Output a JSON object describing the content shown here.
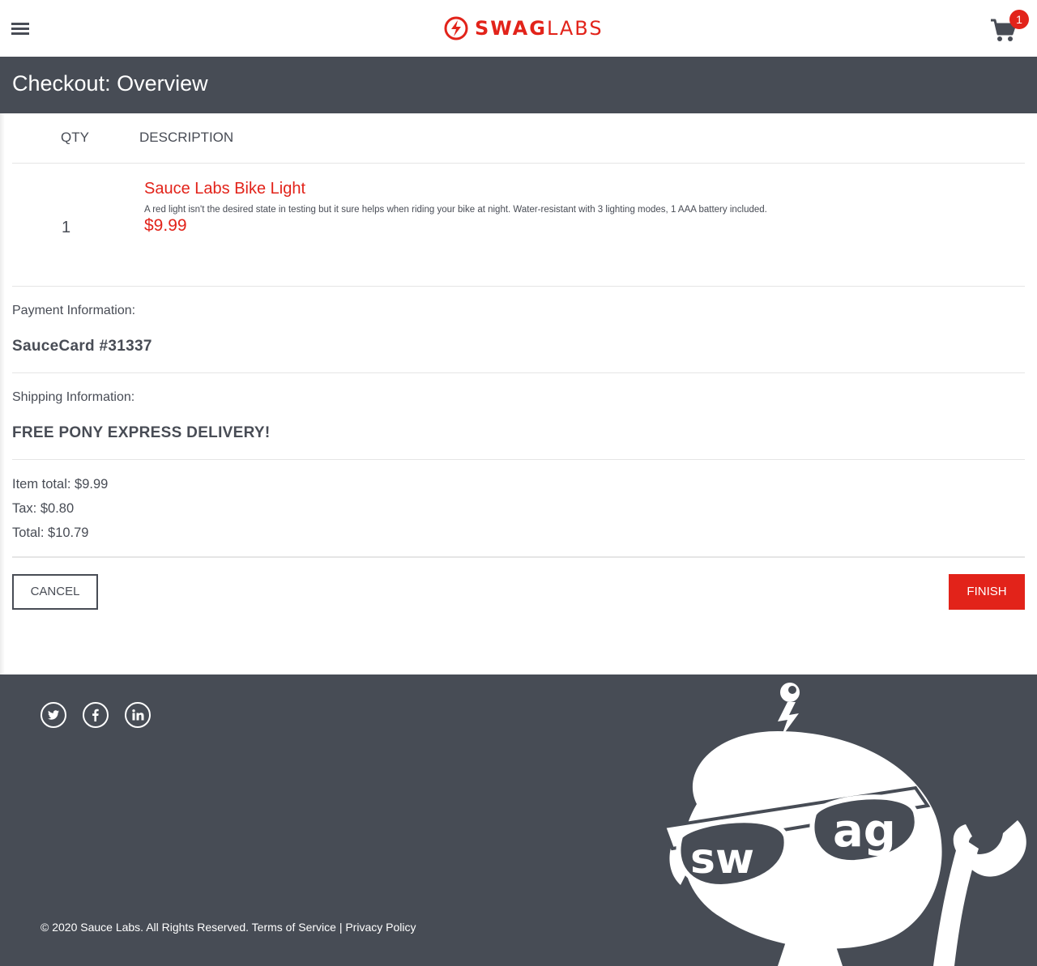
{
  "header": {
    "logo": {
      "bold": "SWAG",
      "light": "LABS"
    },
    "cart_count": "1"
  },
  "subheader": {
    "title": "Checkout: Overview"
  },
  "table": {
    "qty_label": "QTY",
    "desc_label": "DESCRIPTION",
    "items": [
      {
        "qty": "1",
        "name": "Sauce Labs Bike Light",
        "description": "A red light isn't the desired state in testing but it sure helps when riding your bike at night. Water-resistant with 3 lighting modes, 1 AAA battery included.",
        "price": "$9.99"
      }
    ]
  },
  "payment": {
    "label": "Payment Information:",
    "value": "SauceCard #31337"
  },
  "shipping": {
    "label": "Shipping Information:",
    "value": "FREE PONY EXPRESS DELIVERY!"
  },
  "summary": {
    "item_total": "Item total: $9.99",
    "tax": "Tax: $0.80",
    "total": "Total: $10.79"
  },
  "buttons": {
    "cancel": "CANCEL",
    "finish": "FINISH"
  },
  "footer": {
    "social": [
      "twitter-icon",
      "facebook-icon",
      "linkedin-icon"
    ],
    "copyright": "© 2020 Sauce Labs. All Rights Reserved.",
    "terms": "Terms of Service",
    "separator": "|",
    "privacy": "Privacy Policy",
    "mascot_text": "swag"
  },
  "colors": {
    "accent": "#e2231a",
    "dark": "#474c55",
    "text": "#484c55"
  }
}
